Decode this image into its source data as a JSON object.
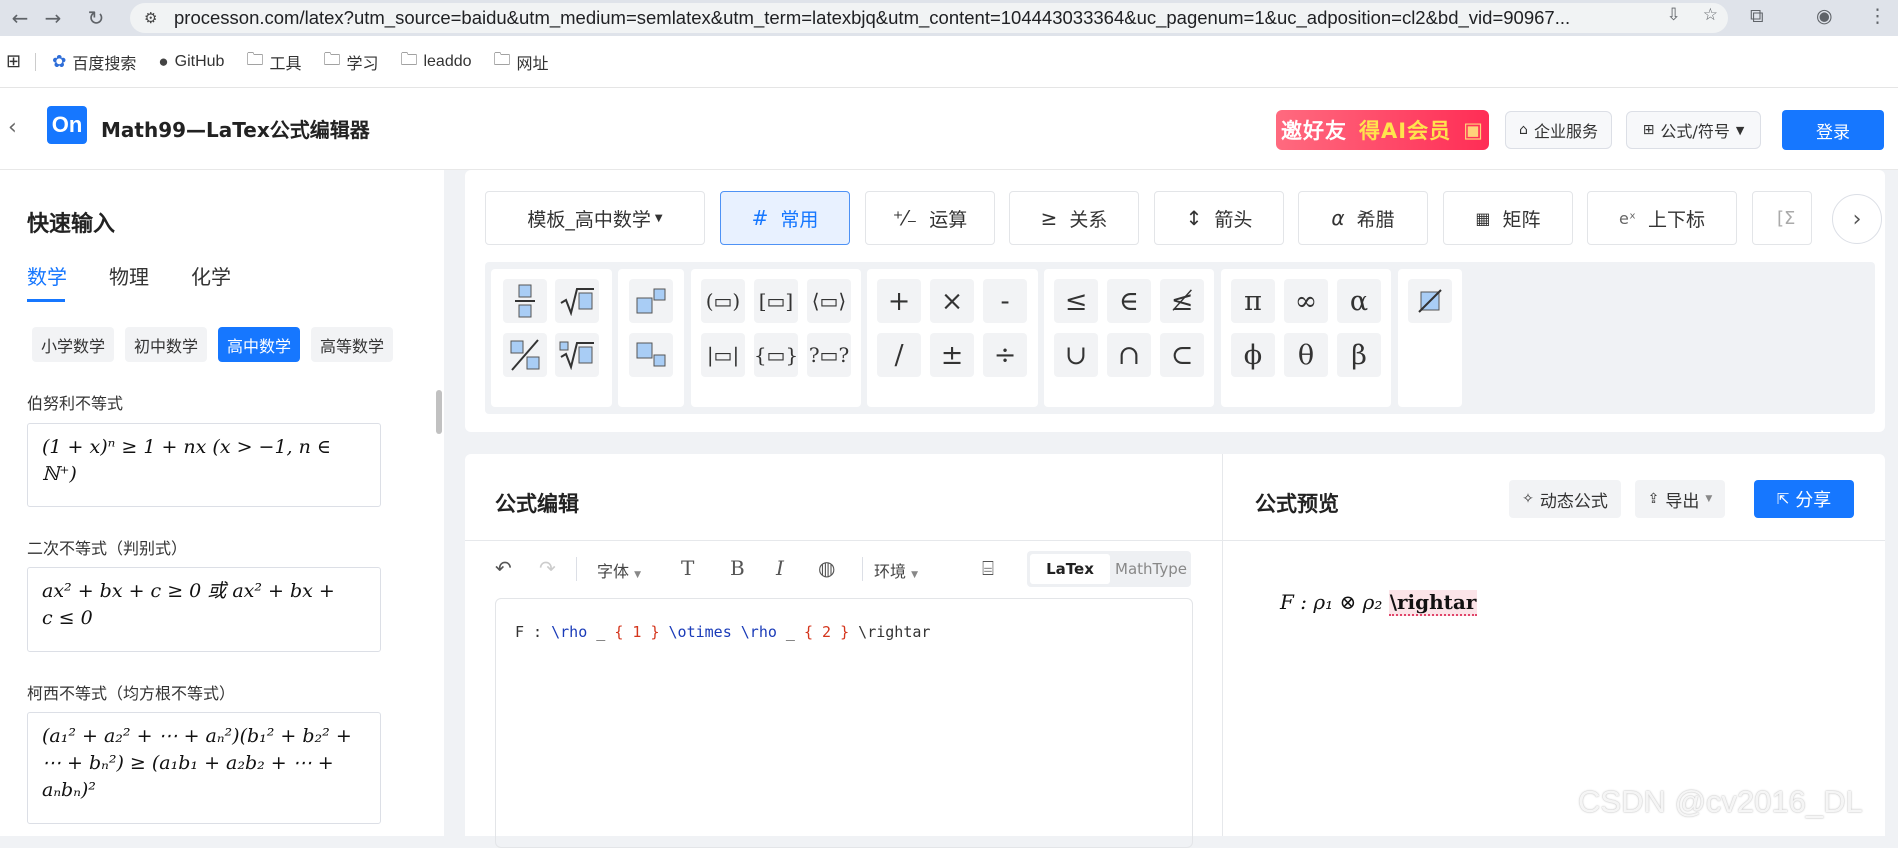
{
  "browser": {
    "url": "processon.com/latex?utm_source=baidu&utm_medium=semlatex&utm_term=latexbjq&utm_content=104443033364&uc_pagenum=1&uc_adposition=cl2&bd_vid=90967...",
    "bookmarks": [
      "百度搜索",
      "GitHub",
      "工具",
      "学习",
      "leaddo",
      "网址"
    ]
  },
  "header": {
    "logo": "On",
    "title": "Math99—LaTex公式编辑器",
    "promo_part1": "邀好友",
    "promo_part2": "得AI会员",
    "enterprise": "企业服务",
    "formula_symbols": "公式/符号",
    "login": "登录"
  },
  "sidebar": {
    "title": "快速输入",
    "tabs": [
      "数学",
      "物理",
      "化学"
    ],
    "chips": [
      "小学数学",
      "初中数学",
      "高中数学",
      "高等数学"
    ],
    "formulas": [
      {
        "label": "伯努利不等式",
        "line1": "(1 + x)ⁿ ≥ 1 + nx   (x > −1, n ∈",
        "line2": "ℕ⁺)"
      },
      {
        "label": "二次不等式（判别式）",
        "line1": "ax² + bx + c ≥ 0 或 ax² + bx +",
        "line2": "c ≤ 0"
      },
      {
        "label": "柯西不等式（均方根不等式）",
        "line1": "(a₁² + a₂² + ⋯ + aₙ²)(b₁² + b₂² +",
        "line2": "⋯ + bₙ²) ≥ (a₁b₁ + a₂b₂ + ⋯ +",
        "line3": "aₙbₙ)²"
      }
    ]
  },
  "toolbar": {
    "template": "模板_高中数学",
    "categories": [
      {
        "icon": "#",
        "label": "常用"
      },
      {
        "icon": "⁺⁄₋",
        "label": "运算"
      },
      {
        "icon": "≥",
        "label": "关系"
      },
      {
        "icon": "↕",
        "label": "箭头"
      },
      {
        "icon": "α",
        "label": "希腊"
      },
      {
        "icon": "▦",
        "label": "矩阵"
      },
      {
        "icon": "eˣ",
        "label": "上下标"
      },
      {
        "icon": "[Σ",
        "label": ""
      }
    ],
    "ops": [
      "+",
      "×",
      "-",
      "/",
      "±",
      "÷"
    ],
    "relations": [
      "≤",
      "∈",
      "≰",
      "∪",
      "∩",
      "⊂"
    ],
    "greek": [
      "π",
      "∞",
      "α",
      "ϕ",
      "θ",
      "β"
    ]
  },
  "editor": {
    "title": "公式编辑",
    "font": "字体",
    "env": "环境",
    "mode_latex": "LaTex",
    "mode_mathtype": "MathType",
    "code": {
      "p1": "F : ",
      "c1": "\\rho",
      "p2": " _ ",
      "b1": "{ 1 }",
      "p3": " ",
      "c2": "\\otimes",
      "p4": " ",
      "c3": "\\rho",
      "p5": " _ ",
      "b2": "{ 2 }",
      "p6": " \\rightar"
    }
  },
  "preview": {
    "title": "公式预览",
    "dynamic": "动态公式",
    "export": "导出",
    "share": "分享",
    "math": "F : ρ₁ ⊗ ρ₂ ",
    "error_cmd": "\\rightar"
  },
  "watermark": "CSDN @cv2016_DL"
}
